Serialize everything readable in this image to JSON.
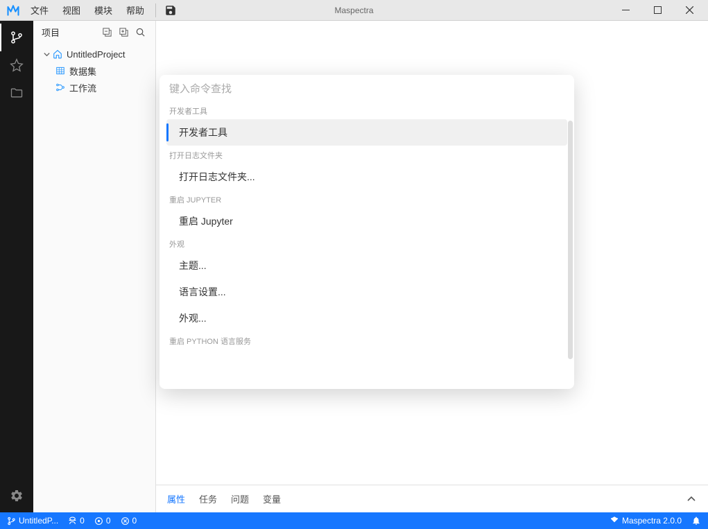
{
  "app": {
    "title": "Maspectra"
  },
  "menubar": {
    "items": [
      "文件",
      "视图",
      "模块",
      "帮助"
    ]
  },
  "sidebar": {
    "title": "项目",
    "tree": {
      "root": "UntitledProject",
      "children": [
        {
          "label": "数据集"
        },
        {
          "label": "工作流"
        }
      ]
    }
  },
  "command_palette": {
    "placeholder": "键入命令查找",
    "groups": [
      {
        "label": "开发者工具",
        "items": [
          "开发者工具"
        ],
        "selected": 0
      },
      {
        "label": "打开日志文件夹",
        "items": [
          "打开日志文件夹..."
        ]
      },
      {
        "label": "重启 JUPYTER",
        "items": [
          "重启 Jupyter"
        ]
      },
      {
        "label": "外观",
        "items": [
          "主题...",
          "语言设置...",
          "外观..."
        ]
      },
      {
        "label": "重启 PYTHON 语言服务",
        "items": []
      }
    ]
  },
  "bottom_panel": {
    "tabs": [
      "属性",
      "任务",
      "问题",
      "变量"
    ],
    "active": 0
  },
  "statusbar": {
    "project": "UntitledP...",
    "counts": {
      "a": "0",
      "b": "0",
      "c": "0"
    },
    "version": "Maspectra 2.0.0"
  }
}
